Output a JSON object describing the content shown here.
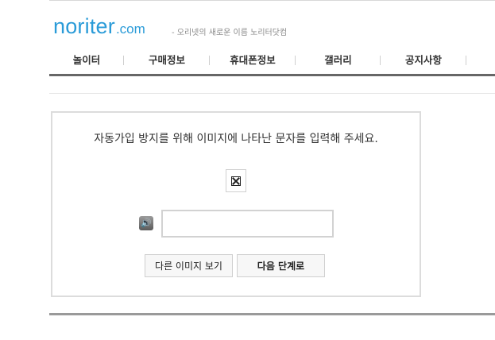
{
  "header": {
    "logo_main": "noriter",
    "logo_suffix": ".com",
    "slogan": "- 오리넷의 새로운 이름 노리터닷컴"
  },
  "nav": {
    "items": [
      {
        "label": "놀이터"
      },
      {
        "label": "구매정보"
      },
      {
        "label": "휴대폰정보"
      },
      {
        "label": "갤러리"
      },
      {
        "label": "공지사항"
      }
    ]
  },
  "captcha": {
    "instruction": "자동가입 방지를 위해 이미지에 나타난 문자를 입력해 주세요.",
    "audio_icon": "speaker-icon",
    "input_value": "",
    "input_placeholder": "",
    "other_image_button": "다른 이미지 보기",
    "next_button": "다음 단계로"
  },
  "colors": {
    "brand": "#2a9bd8",
    "nav_rule": "#676767"
  }
}
